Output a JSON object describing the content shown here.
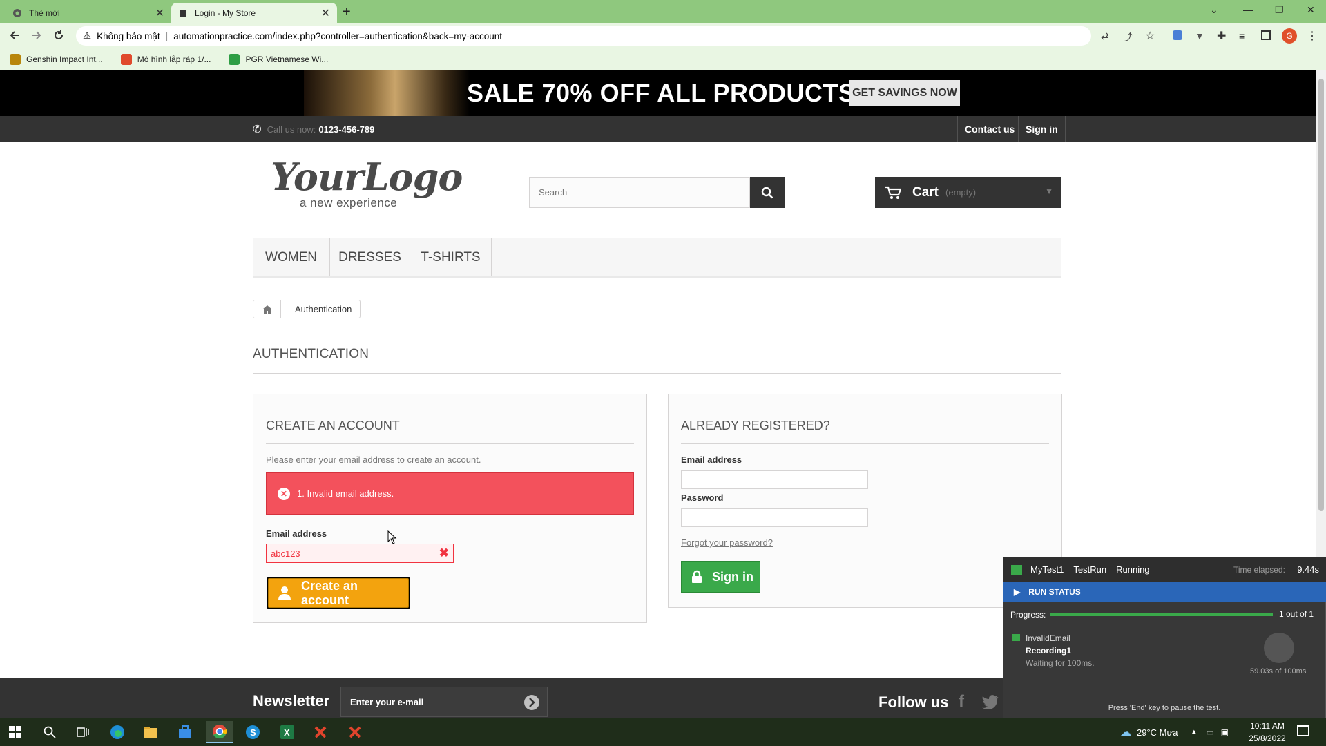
{
  "browser": {
    "tabs": [
      {
        "label": "Thẻ mới"
      },
      {
        "label": "Login - My Store"
      }
    ],
    "address": {
      "security_label": "Không bảo mật",
      "url": "automationpractice.com/index.php?controller=authentication&back=my-account"
    },
    "bookmarks": [
      {
        "label": "Genshin Impact Int...",
        "color": "#b8860b"
      },
      {
        "label": "Mô hình lắp ráp 1/...",
        "color": "#e04a2c"
      },
      {
        "label": "PGR Vietnamese Wi...",
        "color": "#2e9e44"
      }
    ],
    "profile_initial": "G"
  },
  "banner": {
    "text": "SALE 70% OFF ALL PRODUCTS",
    "button": "GET SAVINGS NOW"
  },
  "topnav": {
    "call_label": "Call us now:",
    "phone": "0123-456-789",
    "contact": "Contact us",
    "signin": "Sign in"
  },
  "header": {
    "logo_main": "YourLogo",
    "logo_sub": "a new experience",
    "search_placeholder": "Search",
    "cart_label": "Cart",
    "cart_status": "(empty)"
  },
  "menu": [
    "WOMEN",
    "DRESSES",
    "T-SHIRTS"
  ],
  "breadcrumb": {
    "current": "Authentication"
  },
  "page_title": "AUTHENTICATION",
  "create_account": {
    "heading": "CREATE AN ACCOUNT",
    "intro": "Please enter your email address to create an account.",
    "error": "1. Invalid email address.",
    "email_label": "Email address",
    "email_value": "abc123",
    "button": "Create an account"
  },
  "login": {
    "heading": "ALREADY REGISTERED?",
    "email_label": "Email address",
    "password_label": "Password",
    "forgot": "Forgot your password?",
    "button": "Sign in"
  },
  "footer": {
    "newsletter": "Newsletter",
    "newsletter_placeholder": "Enter your e-mail",
    "follow": "Follow us"
  },
  "run_panel": {
    "test": "MyTest1",
    "run": "TestRun",
    "state": "Running",
    "time_label": "Time elapsed:",
    "time": "9.44s",
    "status_label": "RUN STATUS",
    "progress_label": "Progress:",
    "progress_fraction": 1.0,
    "progress_count": "1 out of 1",
    "test_item": "InvalidEmail",
    "recording": "Recording1",
    "waiting": "Waiting for 100ms.",
    "wait_progress": "59.03s of 100ms",
    "footer_hint": "Press 'End' key to pause the test."
  },
  "taskbar": {
    "weather": "29°C  Mưa",
    "time": "10:11 AM",
    "date": "25/8/2022"
  }
}
